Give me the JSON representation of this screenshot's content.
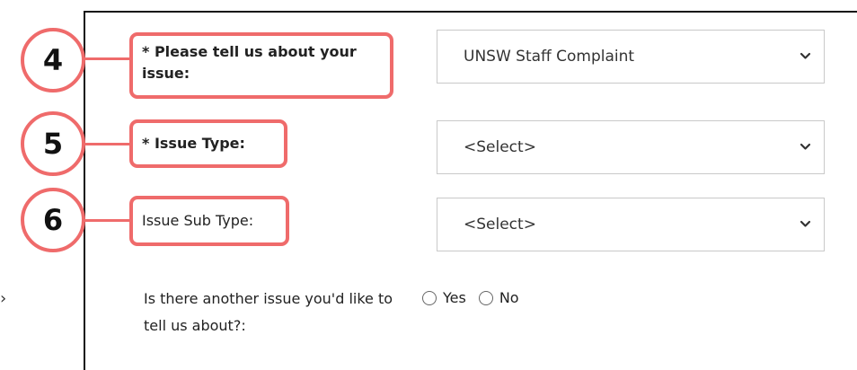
{
  "form": {
    "issue": {
      "callout": "4",
      "label": "* Please tell us about your issue:",
      "selected": "UNSW Staff Complaint"
    },
    "issue_type": {
      "callout": "5",
      "label": "* Issue Type:",
      "selected": "<Select>"
    },
    "issue_sub_type": {
      "callout": "6",
      "label": "Issue Sub Type:",
      "selected": "<Select>"
    },
    "another_issue": {
      "question": "Is there another issue you'd like to tell us about?:",
      "options": [
        "Yes",
        "No"
      ]
    }
  },
  "colors": {
    "callout_accent": "#ef6b6b",
    "border": "#c9c9c9"
  },
  "icons": {
    "select_arrow": "chevron-down-icon",
    "radio": "radio-button-icon"
  }
}
